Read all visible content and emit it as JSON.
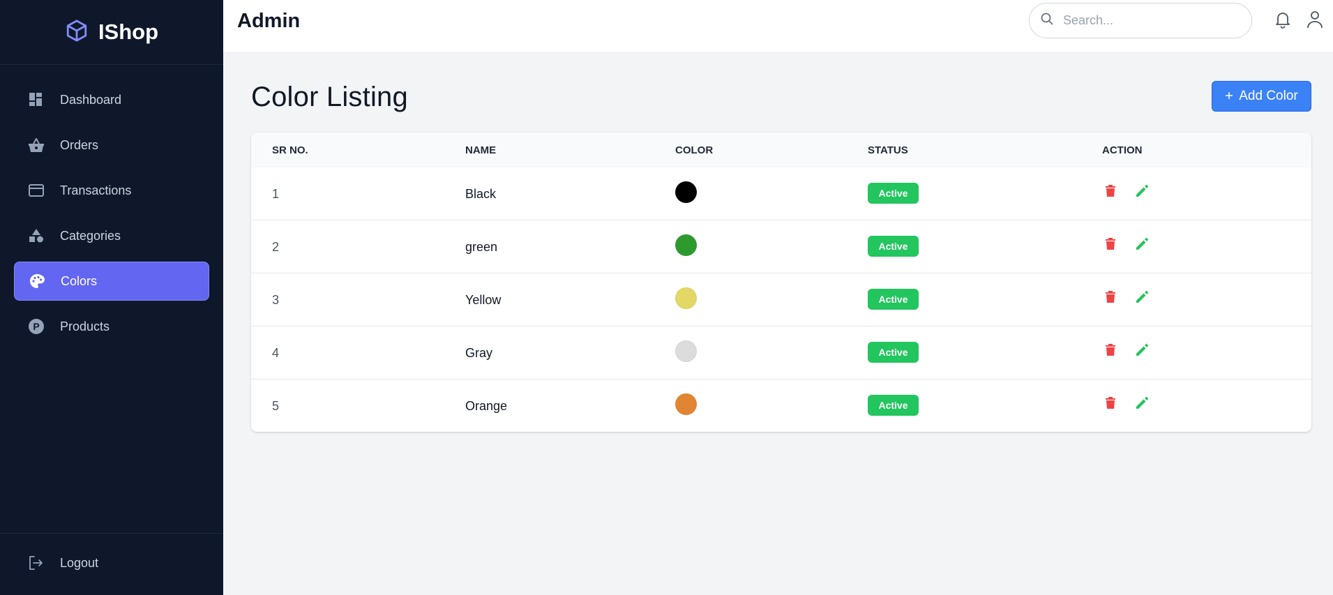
{
  "app": {
    "brand": "IShop",
    "brand_color": "#818cf8"
  },
  "sidebar": {
    "items": [
      {
        "label": "Dashboard",
        "icon": "dashboard-icon"
      },
      {
        "label": "Orders",
        "icon": "basket-icon"
      },
      {
        "label": "Transactions",
        "icon": "credit-card-icon"
      },
      {
        "label": "Categories",
        "icon": "shapes-icon"
      },
      {
        "label": "Colors",
        "icon": "palette-icon",
        "active": true
      },
      {
        "label": "Products",
        "icon": "p-circle-icon"
      }
    ],
    "logout": "Logout"
  },
  "topbar": {
    "title": "Admin",
    "search_placeholder": "Search..."
  },
  "main": {
    "title": "Color Listing",
    "add_button": "Add Color",
    "accent": "#3b82f6"
  },
  "table": {
    "headers": {
      "sr": "SR NO.",
      "name": "NAME",
      "color": "COLOR",
      "status": "STATUS",
      "action": "ACTION"
    },
    "rows": [
      {
        "sr": "1",
        "name": "Black",
        "swatch": "#000000",
        "status": "Active"
      },
      {
        "sr": "2",
        "name": "green",
        "swatch": "#2e9a2e",
        "status": "Active"
      },
      {
        "sr": "3",
        "name": "Yellow",
        "swatch": "#e3d766",
        "status": "Active"
      },
      {
        "sr": "4",
        "name": "Gray",
        "swatch": "#dcdcdc",
        "status": "Active"
      },
      {
        "sr": "5",
        "name": "Orange",
        "swatch": "#e08533",
        "status": "Active"
      }
    ],
    "status_color": "#22c55e",
    "delete_color": "#ef4444",
    "edit_color": "#22c55e"
  }
}
